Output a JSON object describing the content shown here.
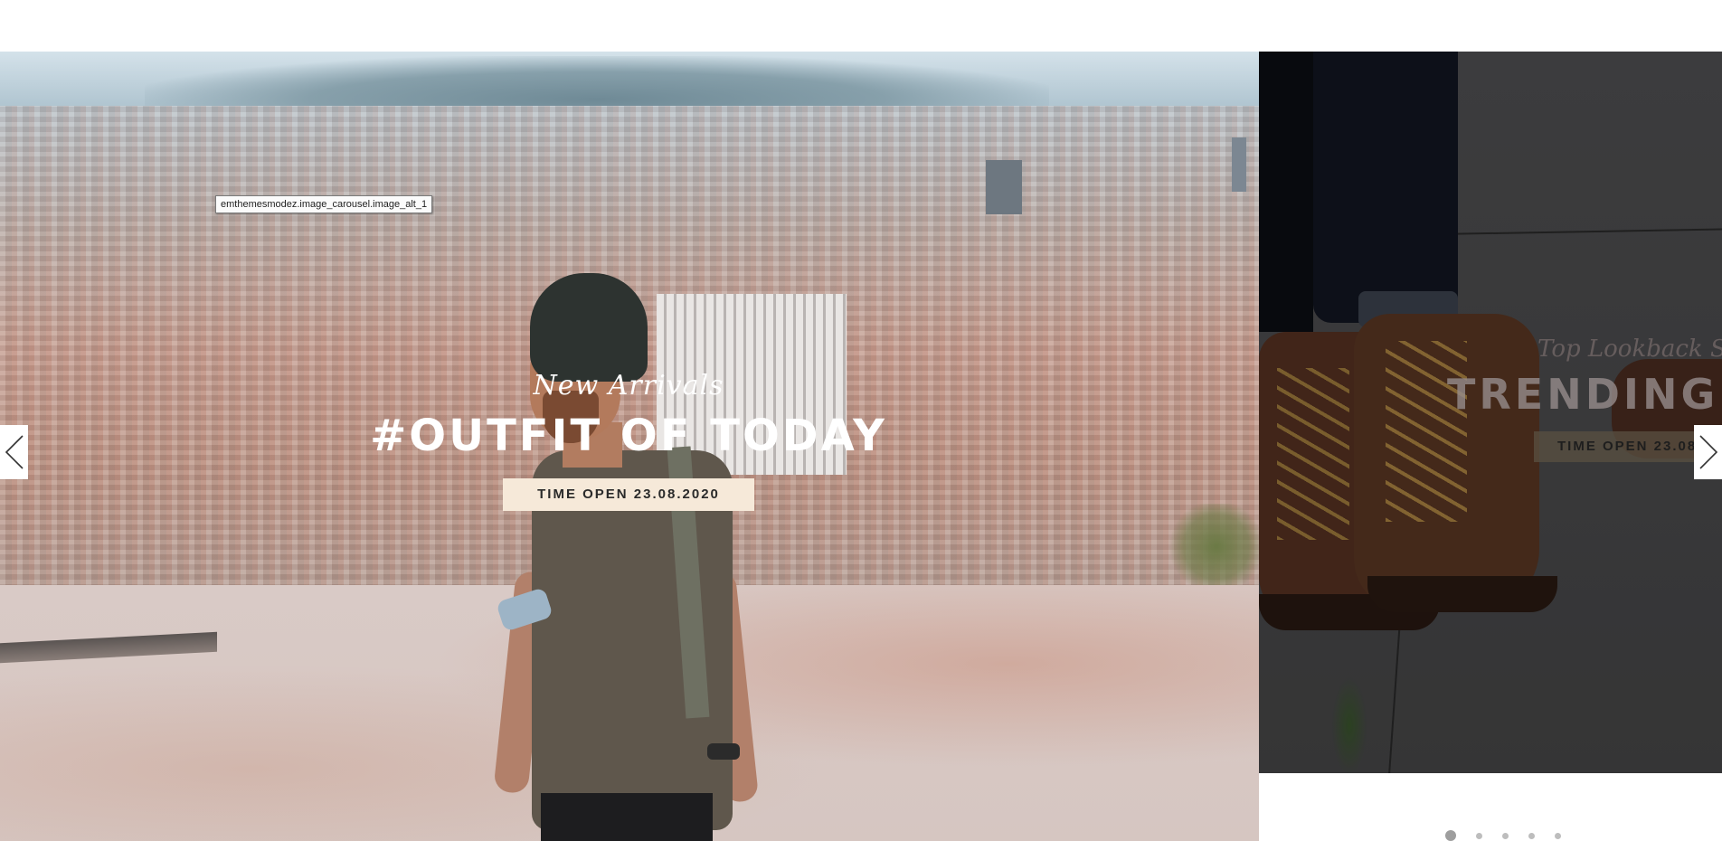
{
  "tooltip": {
    "text": "emthemesmodez.image_carousel.image_alt_1"
  },
  "slides": [
    {
      "eyebrow": "New Arrivals",
      "headline": "#OUTFIT OF TODAY",
      "cta_label": "TIME OPEN 23.08.2020",
      "cta_color": "#f6e9d9"
    },
    {
      "eyebrow": "Top Lookback S",
      "headline": "TRENDING IN",
      "cta_label": "TIME OPEN 23.08"
    }
  ],
  "arrows": {
    "prev_icon": "chevron-left-icon",
    "next_icon": "chevron-right-icon"
  },
  "pagination": {
    "count": 5,
    "active_index": 0
  }
}
